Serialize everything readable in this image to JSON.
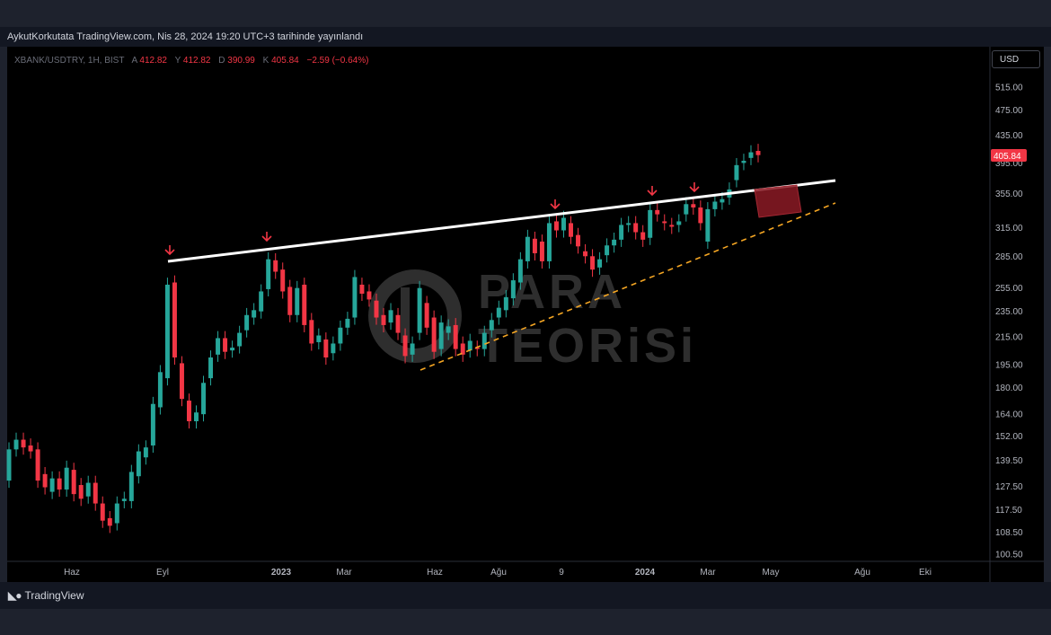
{
  "publication": "AykutKorkutata TradingView.com, Nis 28, 2024 19:20 UTC+3 tarihinde yayınlandı",
  "legend": {
    "symbol": "XBANK/USDTRY, 1H, BIST",
    "open_label": "A",
    "open": "412.82",
    "high_label": "Y",
    "high": "412.82",
    "low_label": "D",
    "low": "390.99",
    "close_label": "K",
    "close": "405.84",
    "change": "−2.59 (−0.64%)"
  },
  "currency_button": "USD",
  "last_price": "405.84",
  "watermark": {
    "line1": "PARA",
    "line2": "TEORiSi"
  },
  "footer_brand": "TradingView",
  "colors": {
    "up": "#26a69a",
    "down": "#f23645",
    "trendline": "#ffffff",
    "support": "#f5a623",
    "arrow": "#f23645",
    "box": "#8b1a24"
  },
  "chart_data": {
    "type": "candlestick",
    "y_scale": "log",
    "y_ticks": [
      "515.00",
      "475.00",
      "435.00",
      "395.00",
      "355.00",
      "315.00",
      "285.00",
      "255.00",
      "235.00",
      "215.00",
      "195.00",
      "180.00",
      "164.00",
      "152.00",
      "139.50",
      "127.50",
      "117.50",
      "108.50",
      "100.50"
    ],
    "x_ticks": [
      "Haz",
      "Eyl",
      "2023",
      "Mar",
      "Haz",
      "Ağu",
      "9",
      "2024",
      "Mar",
      "May",
      "Ağu",
      "Eki"
    ],
    "candles": [
      [
        130,
        145
      ],
      [
        145,
        150
      ],
      [
        150,
        146
      ],
      [
        147,
        144
      ],
      [
        145,
        130
      ],
      [
        133,
        127
      ],
      [
        125,
        131
      ],
      [
        131,
        126
      ],
      [
        126,
        136
      ],
      [
        135,
        124
      ],
      [
        128,
        122
      ],
      [
        123,
        129
      ],
      [
        129,
        120
      ],
      [
        120,
        113
      ],
      [
        114,
        111
      ],
      [
        112,
        120
      ],
      [
        121,
        122
      ],
      [
        121,
        134
      ],
      [
        132,
        144
      ],
      [
        141,
        146
      ],
      [
        147,
        170
      ],
      [
        168,
        190
      ],
      [
        186,
        258
      ],
      [
        260,
        200
      ],
      [
        196,
        173
      ],
      [
        172,
        160
      ],
      [
        160,
        165
      ],
      [
        164,
        183
      ],
      [
        186,
        200
      ],
      [
        202,
        214
      ],
      [
        214,
        204
      ],
      [
        205,
        207
      ],
      [
        208,
        218
      ],
      [
        220,
        232
      ],
      [
        230,
        236
      ],
      [
        235,
        252
      ],
      [
        254,
        282
      ],
      [
        281,
        270
      ],
      [
        272,
        252
      ],
      [
        256,
        232
      ],
      [
        232,
        255
      ],
      [
        258,
        224
      ],
      [
        228,
        210
      ],
      [
        211,
        216
      ],
      [
        213,
        200
      ],
      [
        203,
        210
      ],
      [
        210,
        222
      ],
      [
        222,
        229
      ],
      [
        230,
        265
      ],
      [
        258,
        250
      ],
      [
        252,
        245
      ],
      [
        244,
        230
      ],
      [
        232,
        224
      ],
      [
        226,
        236
      ],
      [
        232,
        218
      ],
      [
        216,
        201
      ],
      [
        202,
        210
      ],
      [
        218,
        255
      ],
      [
        242,
        222
      ],
      [
        230,
        204
      ],
      [
        206,
        226
      ],
      [
        218,
        223
      ],
      [
        224,
        206
      ],
      [
        210,
        202
      ],
      [
        205,
        212
      ],
      [
        207,
        206
      ],
      [
        206,
        218
      ],
      [
        220,
        228
      ],
      [
        230,
        238
      ],
      [
        236,
        247
      ],
      [
        246,
        262
      ],
      [
        260,
        282
      ],
      [
        280,
        305
      ],
      [
        303,
        288
      ],
      [
        300,
        280
      ],
      [
        280,
        320
      ],
      [
        322,
        312
      ],
      [
        312,
        326
      ],
      [
        320,
        305
      ],
      [
        307,
        295
      ],
      [
        290,
        285
      ],
      [
        285,
        272
      ],
      [
        274,
        282
      ],
      [
        286,
        296
      ],
      [
        296,
        302
      ],
      [
        302,
        318
      ],
      [
        318,
        320
      ],
      [
        320,
        310
      ],
      [
        310,
        302
      ],
      [
        304,
        335
      ],
      [
        335,
        330
      ],
      [
        322,
        320
      ],
      [
        318,
        316
      ],
      [
        318,
        322
      ],
      [
        330,
        342
      ],
      [
        342,
        338
      ],
      [
        338,
        320
      ],
      [
        300,
        336
      ],
      [
        336,
        345
      ],
      [
        344,
        348
      ],
      [
        350,
        360
      ],
      [
        372,
        392
      ],
      [
        395,
        398
      ],
      [
        402,
        410
      ],
      [
        412,
        406
      ]
    ]
  }
}
